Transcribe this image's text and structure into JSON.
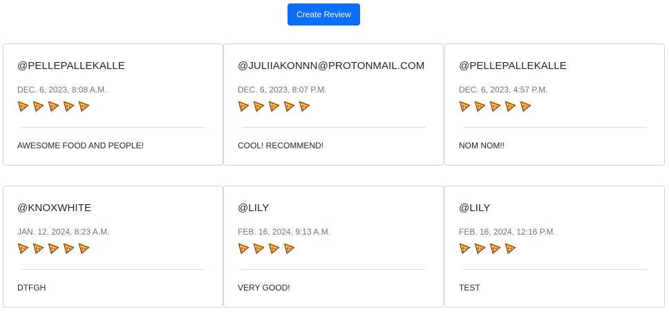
{
  "header": {
    "create_review_label": "Create Review"
  },
  "reviews": [
    {
      "user": "@PELLEPALLEKALLE",
      "date": "DEC. 6, 2023, 8:08 A.M.",
      "rating": 5,
      "comment": "AWESOME FOOD AND PEOPLE!"
    },
    {
      "user": "@JULIIAKONNN@PROTONMAIL.COM",
      "date": "DEC. 6, 2023, 8:07 P.M.",
      "rating": 5,
      "comment": "COOL! RECOMMEND!"
    },
    {
      "user": "@PELLEPALLEKALLE",
      "date": "DEC. 6, 2023, 4:57 P.M.",
      "rating": 5,
      "comment": "NOM NOM!!"
    },
    {
      "user": "@KNOXWHITE",
      "date": "JAN. 12, 2024, 8:23 A.M.",
      "rating": 5,
      "comment": "DTFGH"
    },
    {
      "user": "@LILY",
      "date": "FEB. 16, 2024, 9:13 A.M.",
      "rating": 4,
      "comment": "VERY GOOD!"
    },
    {
      "user": "@LILY",
      "date": "FEB. 16, 2024, 12:16 P.M.",
      "rating": 4,
      "comment": "TEST"
    }
  ],
  "icons": {
    "rating_icon": "pizza-slice-icon"
  },
  "colors": {
    "primary": "#0d6efd",
    "muted_text": "#6c757d",
    "pizza_crust": "#f4a024",
    "pizza_cheese": "#fbd25a",
    "pepperoni": "#d9412b"
  }
}
